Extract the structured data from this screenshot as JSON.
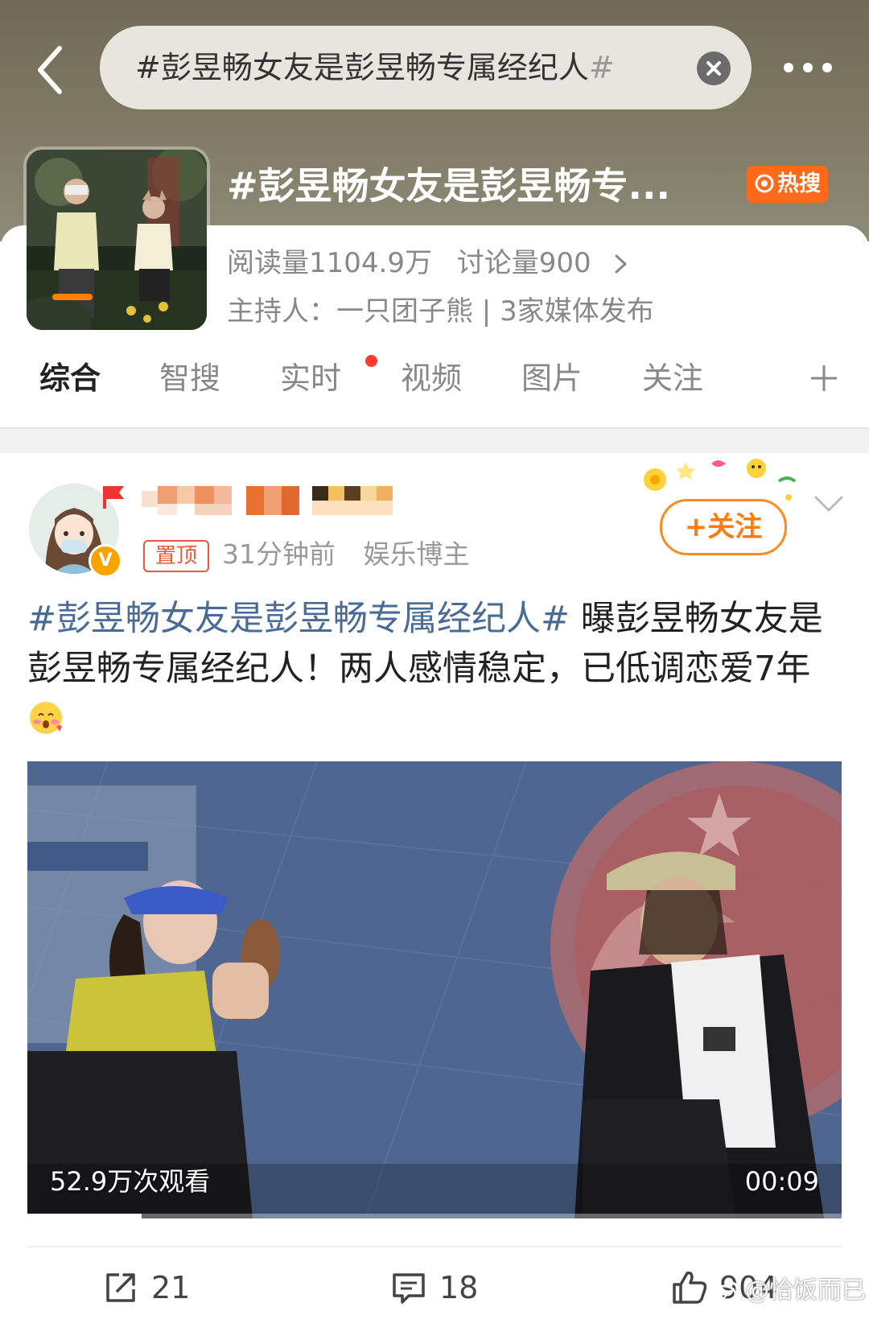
{
  "header": {
    "search_text": "#彭昱畅女友是彭昱畅专属经纪人",
    "search_text_faded": "#",
    "topic_title": "#彭昱畅女友是彭昱畅专...",
    "hot_badge": "热搜"
  },
  "topic": {
    "reads": "阅读量1104.9万",
    "discussions": "讨论量900",
    "host": "主持人：一只团子熊 | 3家媒体发布"
  },
  "tabs": [
    "综合",
    "智搜",
    "实时",
    "视频",
    "图片",
    "关注"
  ],
  "post": {
    "pin_label": "置顶",
    "time": "31分钟前",
    "author_role": "娱乐博主",
    "follow_label": "+关注",
    "hashtag": "#彭昱畅女友是彭昱畅专属经纪人#",
    "body": " 曝彭昱畅女友是彭昱畅专属经纪人！两人感情稳定，已低调恋爱7年"
  },
  "video": {
    "views": "52.9万次观看",
    "duration": "00:09",
    "progress": 0.14
  },
  "actions": {
    "repost_count": "21",
    "comment_count": "18",
    "like_count": "904"
  },
  "watermark": "@恰饭而已",
  "colors": {
    "accent": "#ff8200",
    "hot_badge": "#ff6a1a",
    "hashtag": "#4a6b93",
    "pin": "#e55a3c"
  }
}
